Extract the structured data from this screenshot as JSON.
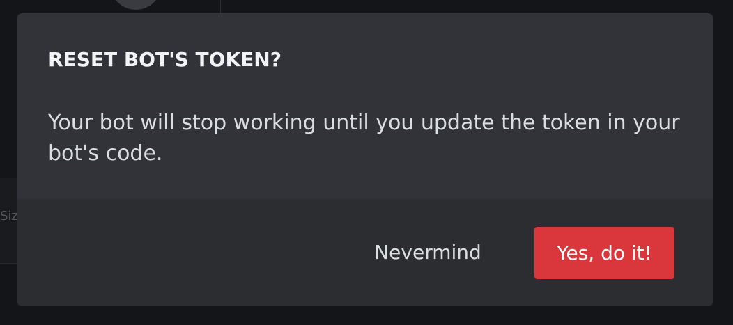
{
  "background": {
    "partial_text": "Siz"
  },
  "modal": {
    "title": "RESET BOT'S TOKEN?",
    "body": "Your bot will stop working until you update the token in your bot's code.",
    "cancel_label": "Nevermind",
    "confirm_label": "Yes, do it!",
    "confirm_color": "#da373c"
  }
}
